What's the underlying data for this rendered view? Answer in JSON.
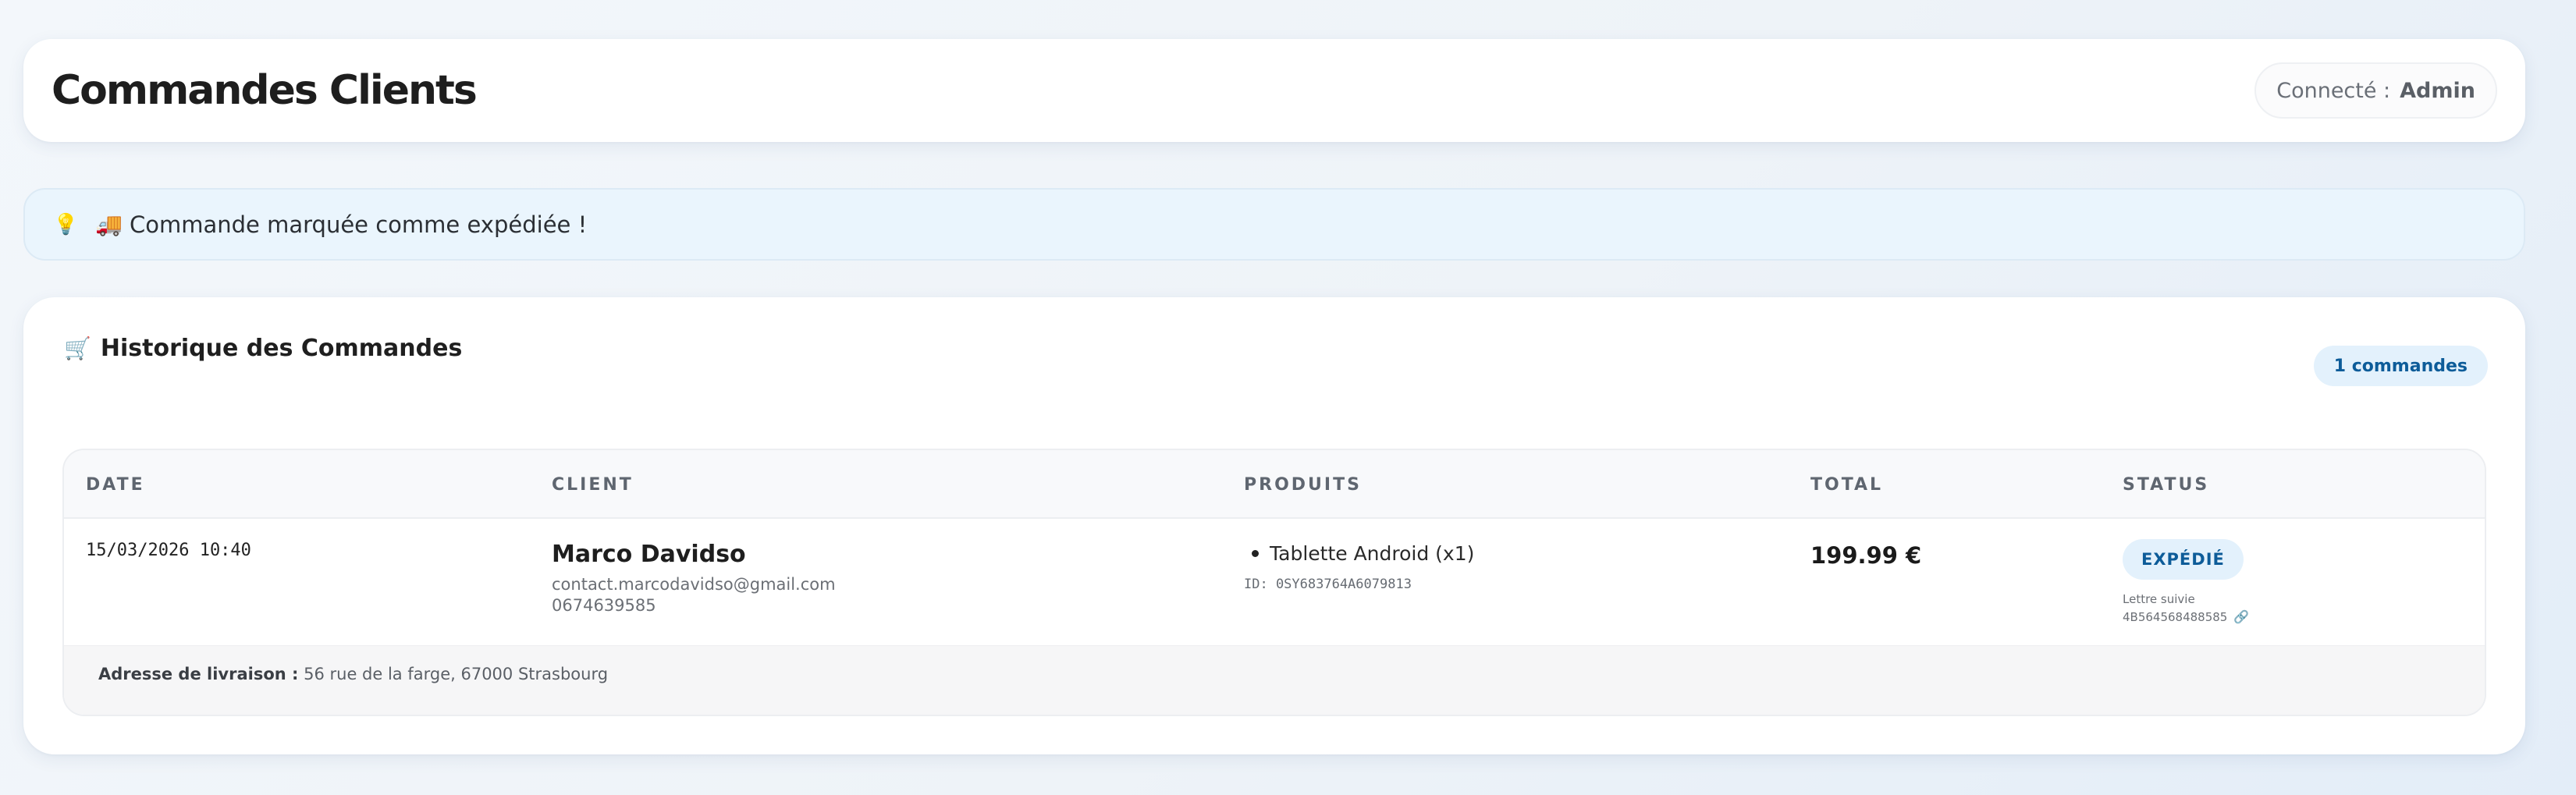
{
  "header": {
    "title": "Commandes Clients",
    "user_label": "Connecté :",
    "user_name": "Admin"
  },
  "alert": {
    "icon": "lightbulb-icon",
    "message_icon": "delivery-truck-icon",
    "bulb_glyph": "💡",
    "truck_glyph": "🚚",
    "message": "Commande marquée comme expédiée !"
  },
  "orders": {
    "cart_glyph": "🛒",
    "title": "Historique des Commandes",
    "count_label": "1 commandes",
    "columns": {
      "date": "DATE",
      "client": "CLIENT",
      "products": "PRODUITS",
      "total": "TOTAL",
      "status": "STATUS"
    },
    "rows": [
      {
        "date": "15/03/2026 10:40",
        "client_name": "Marco Davidso",
        "client_email": "contact.marcodavidso@gmail.com",
        "client_phone": "0674639585",
        "product": "Tablette Android (x1)",
        "product_id": "ID: 0SY683764A6079813",
        "total": "199.99 €",
        "status": "EXPÉDIÉ",
        "tracking_label": "Lettre suivie",
        "tracking_number": "4B564568488585",
        "link_glyph": "🔗",
        "address_label": "Adresse de livraison :",
        "address": "56 rue de la farge, 67000 Strasbourg"
      }
    ]
  },
  "colors": {
    "accent": "#0d5c99",
    "badge_bg": "#e3f1fc",
    "alert_bg": "#eaf5fd"
  }
}
